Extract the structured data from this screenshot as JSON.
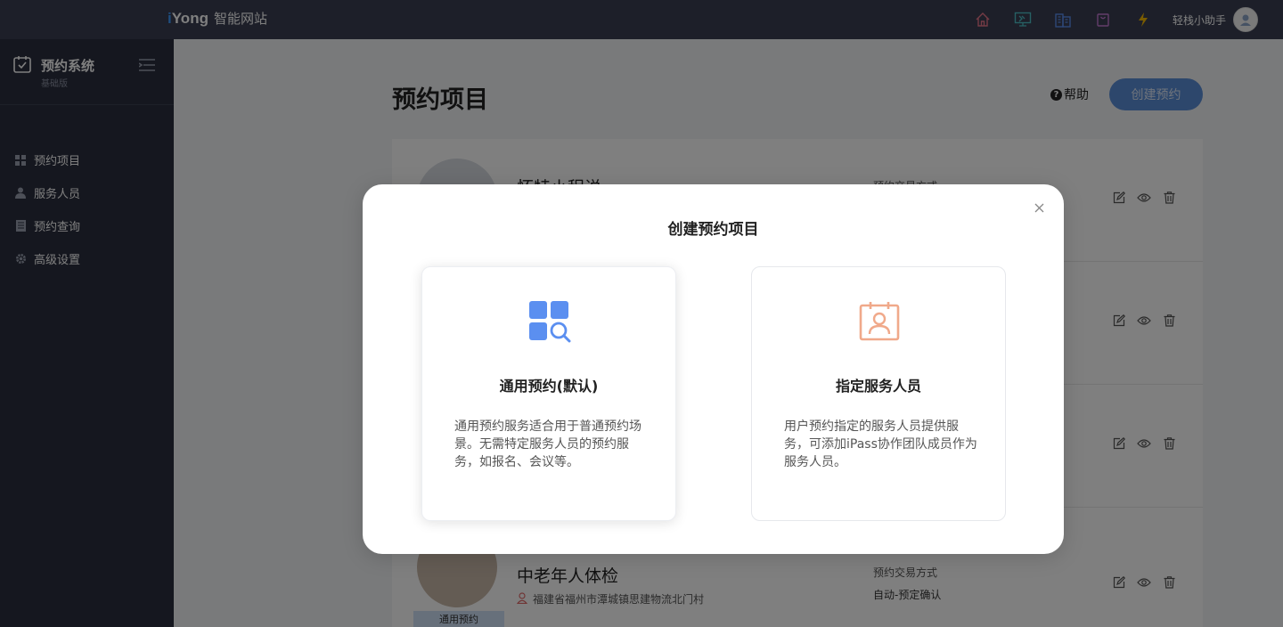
{
  "topbar": {
    "logo_i": "i",
    "logo_rest": "Yong",
    "brand_name": "智能网站",
    "icons": [
      "home-icon",
      "monitor-icon",
      "building-icon",
      "bag-icon",
      "lightning-icon"
    ],
    "user_name": "轻栈小助手"
  },
  "sidebar": {
    "title": "预约系统",
    "subtitle": "基础版",
    "items": [
      {
        "label": "预约项目",
        "icon": "grid-icon"
      },
      {
        "label": "服务人员",
        "icon": "user-icon"
      },
      {
        "label": "预约查询",
        "icon": "list-icon"
      },
      {
        "label": "高级设置",
        "icon": "gear-icon"
      }
    ]
  },
  "main": {
    "title": "预约项目",
    "help_label": "帮助",
    "create_button": "创建预约",
    "rows": [
      {
        "name": "怀特小程说",
        "meta1": "预约交易方式",
        "meta2": ""
      },
      {
        "name": "",
        "meta1": "",
        "meta2": ""
      },
      {
        "name": "",
        "meta1": "",
        "meta2": ""
      },
      {
        "name": "中老年人体检",
        "address": "福建省福州市潭城镇思建物流北门村",
        "meta1": "预约交易方式",
        "meta2": "自动-预定确认",
        "tag": "通用预约"
      }
    ]
  },
  "modal": {
    "title": "创建预约项目",
    "cards": [
      {
        "title": "通用预约(默认)",
        "description": "通用预约服务适合用于普通预约场景。无需特定服务人员的预约服务，如报名、会议等。",
        "icon": "grid-search-icon"
      },
      {
        "title": "指定服务人员",
        "description": "用户预约指定的服务人员提供服务，可添加iPass协作团队成员作为服务人员。",
        "icon": "calendar-person-icon"
      }
    ]
  },
  "colors": {
    "topbar_bg": "#3a3f52",
    "sidebar_bg": "#2b2f3e",
    "accent_blue": "#5b8fd9",
    "icon_blue": "#5b8ff0",
    "icon_orange": "#f0a98a"
  }
}
